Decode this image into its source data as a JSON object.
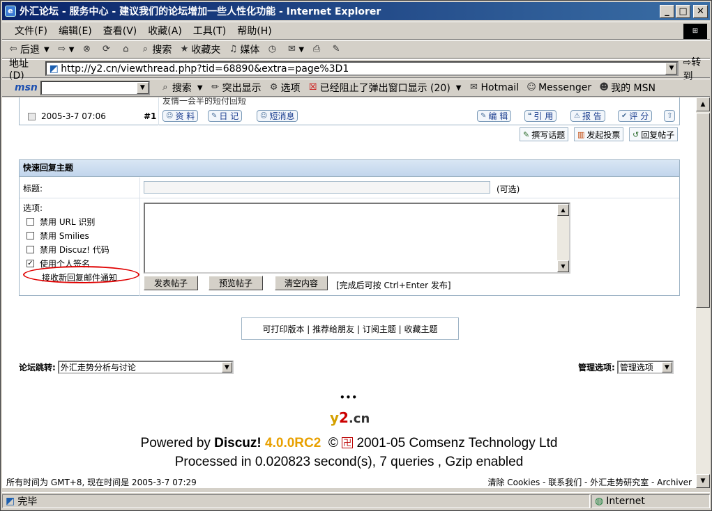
{
  "window": {
    "title": "外汇论坛 - 服务中心 - 建议我们的论坛增加一些人性化功能 - Internet Explorer"
  },
  "menubar": [
    "文件(F)",
    "编辑(E)",
    "查看(V)",
    "收藏(A)",
    "工具(T)",
    "帮助(H)"
  ],
  "toolbar": {
    "back": "后退",
    "search": "搜索",
    "favorites": "收藏夹",
    "media": "媒体"
  },
  "addressbar": {
    "label": "地址(D)",
    "url": "http://y2.cn/viewthread.php?tid=68890&extra=page%3D1",
    "go": "转到"
  },
  "msnbar": {
    "logo": "msn",
    "search": "搜索",
    "highlight": "突出显示",
    "options": "选项",
    "popup_blocked": "已经阻止了弹出窗口显示 (20)",
    "hotmail": "Hotmail",
    "messenger": "Messenger",
    "mymsn": "我的 MSN"
  },
  "post": {
    "snippet": "友情一会半的短付回短",
    "date": "2005-3-7 07:06",
    "floor": "#1",
    "buttons_left": [
      "资 料",
      "日 记",
      "短消息"
    ],
    "buttons_right": [
      "编 辑",
      "引 用",
      "报 告",
      "评 分"
    ]
  },
  "actions": [
    "撰写话题",
    "发起投票",
    "回复帖子"
  ],
  "quick_reply": {
    "header": "快速回复主题",
    "subject_label": "标题:",
    "subject_value": "",
    "optional": "(可选)",
    "options_label": "选项:",
    "options": [
      {
        "label": "禁用 URL 识别",
        "checked": false
      },
      {
        "label": "禁用 Smilies",
        "checked": false
      },
      {
        "label": "禁用 Discuz! 代码",
        "checked": false
      },
      {
        "label": "使用个人签名",
        "checked": true
      },
      {
        "label": "接收新回复邮件通知",
        "checked": false
      }
    ],
    "submit": "发表帖子",
    "preview": "预览帖子",
    "clear": "清空内容",
    "hint": "[完成后可按 Ctrl+Enter 发布]"
  },
  "links": "可打印版本 | 推荐给朋友 | 订阅主题 | 收藏主题",
  "forum_jump": {
    "label": "论坛跳转:",
    "value": "外汇走势分析与讨论"
  },
  "admin": {
    "label": "管理选项:",
    "value": "管理选项"
  },
  "dots": "•••",
  "logo": {
    "y": "y",
    "two": "2",
    "cn": ".cn"
  },
  "footer": {
    "powered_pre": "Powered by ",
    "powered_brand": "Discuz!",
    "version": "4.0.0RC2",
    "copyright_symbol": "©",
    "copyright_mark": "卍",
    "copyright_text": "2001-05 Comsenz Technology Ltd",
    "processed": "Processed in 0.020823 second(s), 7 queries , Gzip enabled",
    "time": "所有时间为 GMT+8, 现在时间是 2005-3-7 07:29",
    "links": "清除 Cookies - 联系我们 - 外汇走势研究室 - Archiver"
  },
  "status": {
    "text": "完毕",
    "zone": "Internet"
  }
}
